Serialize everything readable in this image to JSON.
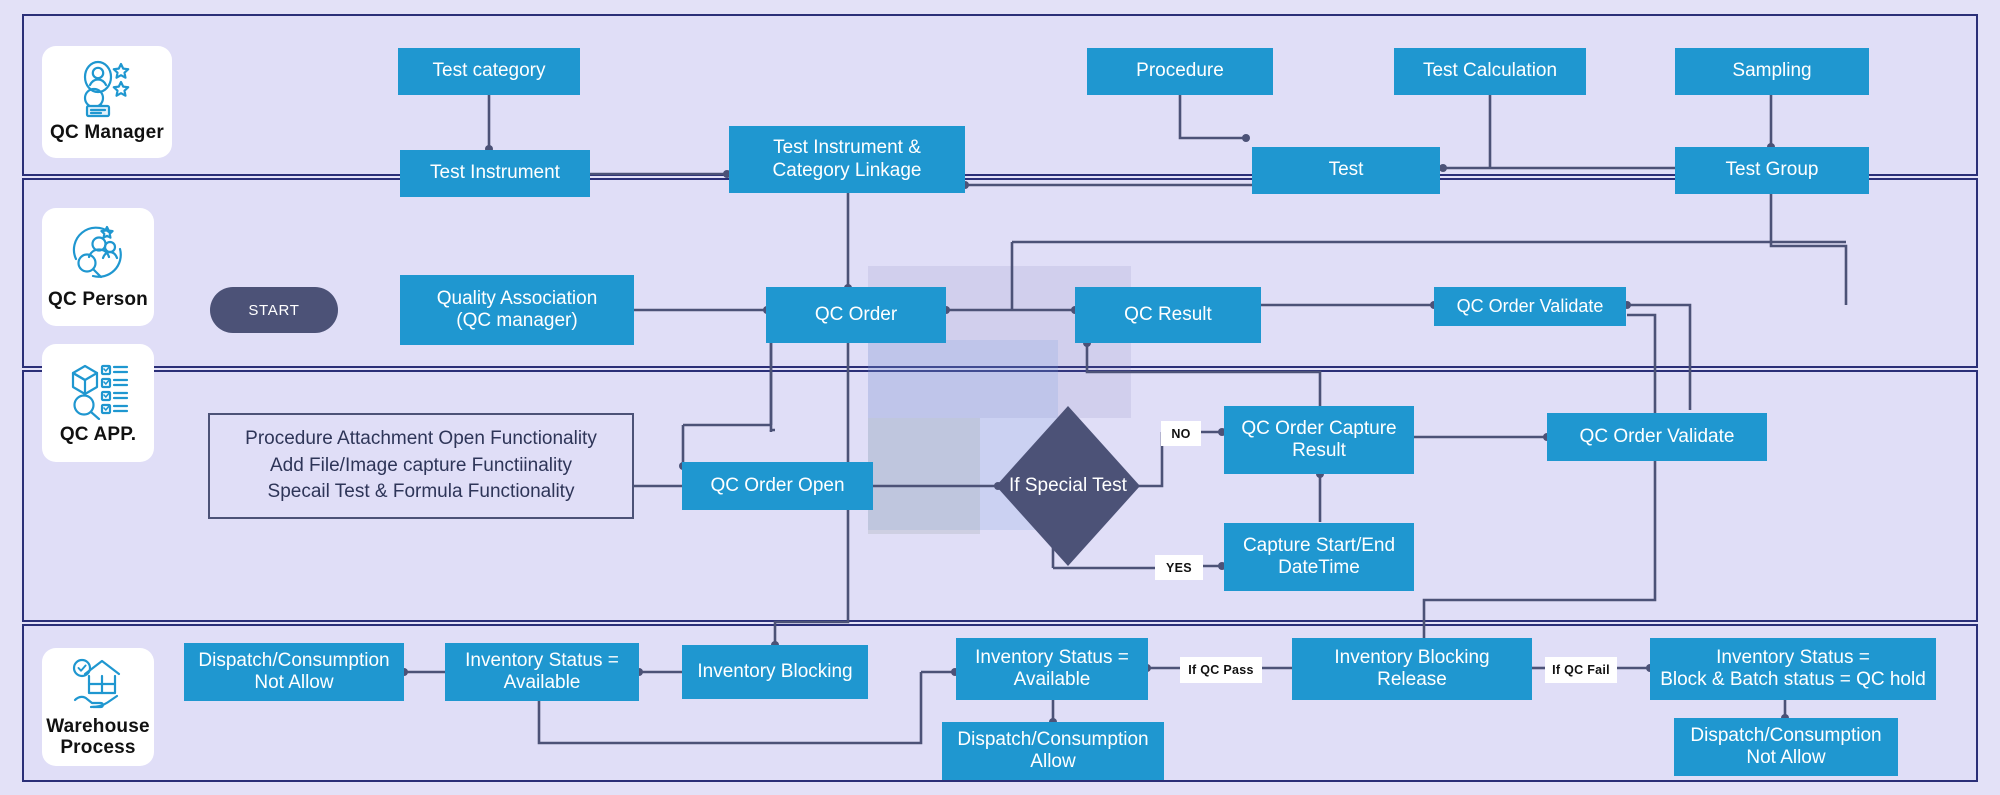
{
  "diagram": {
    "title": "QC Process Swimlane Flow",
    "colors": {
      "canvas": "#e3e1f7",
      "lane_fill": "#e0def7",
      "lane_border": "#2b2f78",
      "node_fill": "#1f97d0",
      "node_text": "#ffffff",
      "accent_dark": "#4c5277",
      "role_card": "#ffffff"
    }
  },
  "lanes": [
    {
      "id": "qc-manager",
      "role": "QC Manager",
      "icon": "qc-manager-badge-icon"
    },
    {
      "id": "qc-person",
      "role": "QC  Person",
      "icon": "qc-person-group-icon"
    },
    {
      "id": "qc-app",
      "role": "QC  APP.",
      "icon": "qc-app-checklist-icon"
    },
    {
      "id": "warehouse",
      "role": "Warehouse\nProcess",
      "role_line1": "Warehouse",
      "role_line2": "Process",
      "icon": "warehouse-hand-icon"
    }
  ],
  "nodes": {
    "test_category": "Test category",
    "test_instrument": "Test Instrument",
    "test_instrument_category_linkage_l1": "Test Instrument &",
    "test_instrument_category_linkage_l2": "Category Linkage",
    "procedure": "Procedure",
    "test": "Test",
    "test_calculation": "Test Calculation",
    "sampling": "Sampling",
    "test_group": "Test Group",
    "start": "START",
    "quality_association_l1": "Quality Association",
    "quality_association_l2": "(QC manager)",
    "qc_order": "QC Order",
    "qc_result": "QC Result",
    "qc_order_validate_row2": "QC Order Validate",
    "qc_app_functions_l1": "Procedure Attachment Open Functionality",
    "qc_app_functions_l2": "Add File/Image capture Functiinality",
    "qc_app_functions_l3": "Specail Test & Formula Functionality",
    "qc_order_open": "QC Order Open",
    "if_special_test": "If Special Test",
    "qc_order_capture_result_l1": "QC Order Capture",
    "qc_order_capture_result_l2": "Result",
    "capture_start_end_datetime_l1": "Capture Start/End",
    "capture_start_end_datetime_l2": "DateTime",
    "qc_order_validate_row3": "QC Order Validate",
    "dispatch_not_allow_left_l1": "Dispatch/Consumption",
    "dispatch_not_allow_left_l2": "Not Allow",
    "inventory_status_available_left_l1": "Inventory Status =",
    "inventory_status_available_left_l2": "Available",
    "inventory_blocking": "Inventory Blocking",
    "inventory_status_available_mid_l1": "Inventory Status =",
    "inventory_status_available_mid_l2": "Available",
    "dispatch_allow_l1": "Dispatch/Consumption",
    "dispatch_allow_l2": "Allow",
    "inventory_blocking_release_l1": "Inventory Blocking",
    "inventory_blocking_release_l2": "Release",
    "inventory_block_qc_hold_l1": "Inventory Status =",
    "inventory_block_qc_hold_l2": "Block & Batch status = QC hold",
    "dispatch_not_allow_right_l1": "Dispatch/Consumption",
    "dispatch_not_allow_right_l2": "Not Allow"
  },
  "edge_labels": {
    "no": "NO",
    "yes": "YES",
    "if_qc_pass": "If QC Pass",
    "if_qc_fail": "If QC Fail"
  }
}
